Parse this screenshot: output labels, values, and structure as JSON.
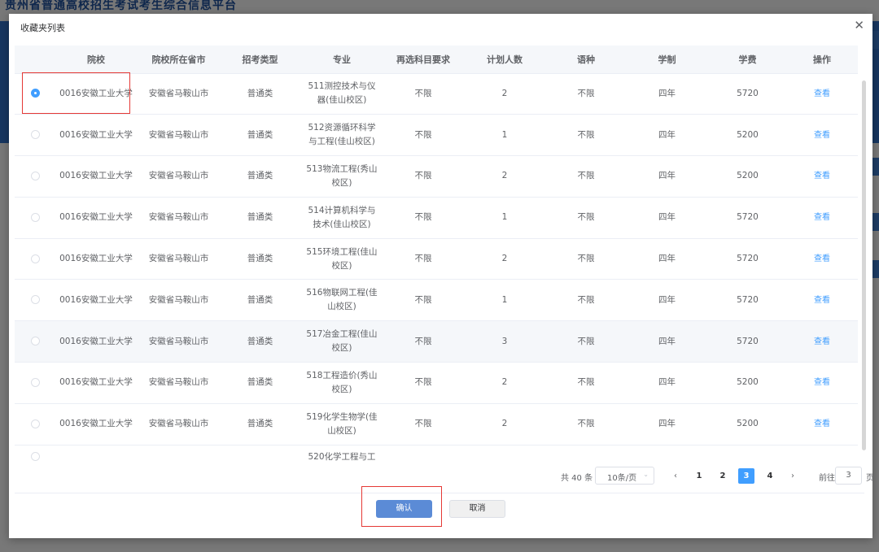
{
  "background": {
    "site_title": "贵州省普通高校招生考试考生综合信息平台"
  },
  "dialog": {
    "title": "收藏夹列表",
    "close_icon": "close-icon"
  },
  "table": {
    "headers": [
      "",
      "院校",
      "院校所在省市",
      "招考类型",
      "专业",
      "再选科目要求",
      "计划人数",
      "语种",
      "学制",
      "学费",
      "操作"
    ],
    "rows": [
      {
        "selected": true,
        "school": "0016安徽工业大学",
        "city": "安徽省马鞍山市",
        "type": "普通类",
        "major": "511测控技术与仪器(佳山校区)",
        "req": "不限",
        "plan": "2",
        "lang": "不限",
        "years": "四年",
        "fee": "5720",
        "action": "查看"
      },
      {
        "selected": false,
        "school": "0016安徽工业大学",
        "city": "安徽省马鞍山市",
        "type": "普通类",
        "major": "512资源循环科学与工程(佳山校区)",
        "req": "不限",
        "plan": "1",
        "lang": "不限",
        "years": "四年",
        "fee": "5200",
        "action": "查看"
      },
      {
        "selected": false,
        "school": "0016安徽工业大学",
        "city": "安徽省马鞍山市",
        "type": "普通类",
        "major": "513物流工程(秀山校区)",
        "req": "不限",
        "plan": "2",
        "lang": "不限",
        "years": "四年",
        "fee": "5200",
        "action": "查看"
      },
      {
        "selected": false,
        "school": "0016安徽工业大学",
        "city": "安徽省马鞍山市",
        "type": "普通类",
        "major": "514计算机科学与技术(佳山校区)",
        "req": "不限",
        "plan": "1",
        "lang": "不限",
        "years": "四年",
        "fee": "5720",
        "action": "查看"
      },
      {
        "selected": false,
        "school": "0016安徽工业大学",
        "city": "安徽省马鞍山市",
        "type": "普通类",
        "major": "515环境工程(佳山校区)",
        "req": "不限",
        "plan": "2",
        "lang": "不限",
        "years": "四年",
        "fee": "5720",
        "action": "查看"
      },
      {
        "selected": false,
        "school": "0016安徽工业大学",
        "city": "安徽省马鞍山市",
        "type": "普通类",
        "major": "516物联网工程(佳山校区)",
        "req": "不限",
        "plan": "1",
        "lang": "不限",
        "years": "四年",
        "fee": "5720",
        "action": "查看"
      },
      {
        "selected": false,
        "school": "0016安徽工业大学",
        "city": "安徽省马鞍山市",
        "type": "普通类",
        "major": "517冶金工程(佳山校区)",
        "req": "不限",
        "plan": "3",
        "lang": "不限",
        "years": "四年",
        "fee": "5720",
        "action": "查看"
      },
      {
        "selected": false,
        "school": "0016安徽工业大学",
        "city": "安徽省马鞍山市",
        "type": "普通类",
        "major": "518工程造价(秀山校区)",
        "req": "不限",
        "plan": "2",
        "lang": "不限",
        "years": "四年",
        "fee": "5200",
        "action": "查看"
      },
      {
        "selected": false,
        "school": "0016安徽工业大学",
        "city": "安徽省马鞍山市",
        "type": "普通类",
        "major": "519化学生物学(佳山校区)",
        "req": "不限",
        "plan": "2",
        "lang": "不限",
        "years": "四年",
        "fee": "5200",
        "action": "查看"
      },
      {
        "selected": false,
        "school": "",
        "city": "",
        "type": "",
        "major": "520化学工程与工",
        "req": "",
        "plan": "",
        "lang": "",
        "years": "",
        "fee": "",
        "action": ""
      }
    ]
  },
  "pagination": {
    "total": "共 40 条",
    "page_size": "10条/页",
    "prev": "‹",
    "next": "›",
    "pages": [
      "1",
      "2",
      "3",
      "4"
    ],
    "current": "3",
    "goto_label": "前往",
    "goto_value": "3",
    "page_unit": "页"
  },
  "footer": {
    "confirm": "确认",
    "cancel": "取消"
  },
  "colors": {
    "accent": "#409eff",
    "confirm": "#5b8bd6",
    "annotation": "#e53935"
  }
}
